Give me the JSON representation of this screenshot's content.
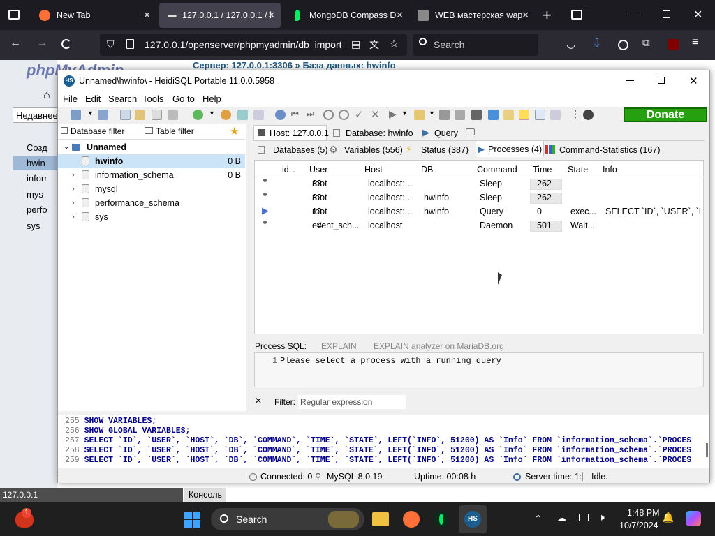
{
  "browser": {
    "tabs": [
      {
        "title": "New Tab",
        "color": "#ff7139"
      },
      {
        "title": "127.0.0.1 / 127.0.0.1 / hw",
        "color": "#f0f0f0"
      },
      {
        "title": "MongoDB Compass Do",
        "color": "#00ed64"
      },
      {
        "title": "WEB мастерская wapinf",
        "color": "#888888"
      }
    ],
    "url": "127.0.0.1/openserver/phpmyadmin/db_import",
    "search_placeholder": "Search"
  },
  "pma": {
    "logo": "phpMyAdmin",
    "breadcrumb_server": "Сервер: 127.0.0.1:3306",
    "breadcrumb_sep": "»",
    "breadcrumb_db": "База данных: hwinfo",
    "left_items": [
      "Созд",
      "hwin",
      "inforr",
      "mys",
      "perfo",
      "sys"
    ],
    "home_label": "Недавнее",
    "bottom_host": "127.0.0.1",
    "console_label": "Консоль"
  },
  "heidi": {
    "title": "Unnamed\\hwinfo\\ - HeidiSQL Portable 11.0.0.5958",
    "menu": [
      "File",
      "Edit",
      "Search",
      "Tools",
      "Go to",
      "Help"
    ],
    "donate": "Donate",
    "db_filter": "Database filter",
    "table_filter": "Table filter",
    "tree": {
      "root": "Unnamed",
      "items": [
        {
          "name": "hwinfo",
          "size": "0 B"
        },
        {
          "name": "information_schema",
          "size": "0 B"
        },
        {
          "name": "mysql",
          "size": ""
        },
        {
          "name": "performance_schema",
          "size": ""
        },
        {
          "name": "sys",
          "size": ""
        }
      ]
    },
    "top_tabs": [
      "Host: 127.0.0.1",
      "Database: hwinfo",
      "Query"
    ],
    "sub_tabs": [
      "Databases (5)",
      "Variables (556)",
      "Status (387)",
      "Processes (4)",
      "Command-Statistics (167)"
    ],
    "grid": {
      "columns": [
        "id",
        "User",
        "Host",
        "DB",
        "Command",
        "Time",
        "State",
        "Info"
      ],
      "rows": [
        [
          "33",
          "root",
          "localhost:...",
          "",
          "Sleep",
          "262",
          "",
          ""
        ],
        [
          "32",
          "root",
          "localhost:...",
          "hwinfo",
          "Sleep",
          "262",
          "",
          ""
        ],
        [
          "13",
          "root",
          "localhost:...",
          "hwinfo",
          "Query",
          "0",
          "exec...",
          "SELECT `ID`, `USER`, `HO..."
        ],
        [
          "4",
          "event_sch...",
          "localhost",
          "",
          "Daemon",
          "501",
          "Wait...",
          ""
        ]
      ]
    },
    "process_sql_label": "Process SQL:",
    "explain": "EXPLAIN",
    "explain_analyzer": "EXPLAIN analyzer on MariaDB.org",
    "sql_line_no": "1",
    "sql_text": "Please select a process with a running query",
    "filter_label": "Filter:",
    "filter_placeholder": "Regular expression",
    "log": [
      {
        "n": "255",
        "text": "SHOW VARIABLES;"
      },
      {
        "n": "256",
        "text": "SHOW GLOBAL VARIABLES;"
      },
      {
        "n": "257",
        "text": "SELECT `ID`, `USER`, `HOST`, `DB`, `COMMAND`, `TIME`, `STATE`, LEFT(`INFO`, 51200) AS `Info` FROM `information_schema`.`PROCES"
      },
      {
        "n": "258",
        "text": "SELECT `ID`, `USER`, `HOST`, `DB`, `COMMAND`, `TIME`, `STATE`, LEFT(`INFO`, 51200) AS `Info` FROM `information_schema`.`PROCES"
      },
      {
        "n": "259",
        "text": "SELECT `ID`, `USER`, `HOST`, `DB`, `COMMAND`, `TIME`, `STATE`, LEFT(`INFO`, 51200) AS `Info` FROM `information_schema`.`PROCES"
      }
    ],
    "status": {
      "connected": "Connected: 0(",
      "version": "MySQL 8.0.19",
      "uptime": "Uptime: 00:08 h",
      "server_time": "Server time: 1:",
      "idle": "Idle."
    }
  },
  "taskbar": {
    "search": "Search",
    "time": "1:48 PM",
    "date": "10/7/2024",
    "notif_count": "1"
  }
}
